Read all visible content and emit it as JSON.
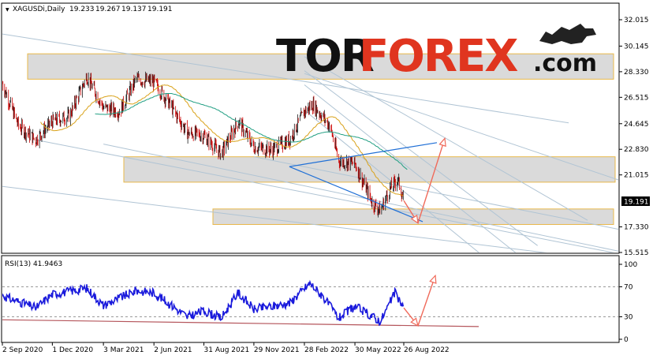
{
  "chart_data": [
    {
      "type": "candlestick",
      "header": {
        "symbol": "XAGUSDi,Daily",
        "open": "19.233",
        "high": "19.267",
        "low": "19.137",
        "close": "19.191"
      },
      "last_price_tag": "19.191",
      "y_ticks": [
        "32.015",
        "30.145",
        "28.330",
        "26.515",
        "24.645",
        "22.830",
        "21.015",
        "19.191",
        "17.330",
        "15.515"
      ],
      "ylim": [
        15.515,
        32.015
      ],
      "x_ticks": [
        "2 Sep 2020",
        "1 Dec 2020",
        "3 Mar 2021",
        "2 Jun 2021",
        "31 Aug 2021",
        "29 Nov 2021",
        "28 Feb 2022",
        "30 May 2022",
        "26 Aug 2022"
      ],
      "approx_close_path": [
        {
          "x": "2 Sep 2020",
          "y": 27.5
        },
        {
          "x": "1 Oct 2020",
          "y": 24.5
        },
        {
          "x": "1 Nov 2020",
          "y": 23.5
        },
        {
          "x": "1 Dec 2020",
          "y": 24.8
        },
        {
          "x": "1 Jan 2021",
          "y": 25.2
        },
        {
          "x": "1 Feb 2021",
          "y": 28.0
        },
        {
          "x": "3 Mar 2021",
          "y": 25.8
        },
        {
          "x": "1 Apr 2021",
          "y": 25.5
        },
        {
          "x": "1 May 2021",
          "y": 27.8
        },
        {
          "x": "2 Jun 2021",
          "y": 27.6
        },
        {
          "x": "1 Jul 2021",
          "y": 26.0
        },
        {
          "x": "1 Aug 2021",
          "y": 24.0
        },
        {
          "x": "31 Aug 2021",
          "y": 23.8
        },
        {
          "x": "1 Oct 2021",
          "y": 22.5
        },
        {
          "x": "1 Nov 2021",
          "y": 24.8
        },
        {
          "x": "29 Nov 2021",
          "y": 23.0
        },
        {
          "x": "1 Jan 2022",
          "y": 22.8
        },
        {
          "x": "1 Feb 2022",
          "y": 23.5
        },
        {
          "x": "28 Feb 2022",
          "y": 25.5
        },
        {
          "x": "15 Mar 2022",
          "y": 26.0
        },
        {
          "x": "15 Apr 2022",
          "y": 24.5
        },
        {
          "x": "1 May 2022",
          "y": 22.0
        },
        {
          "x": "30 May 2022",
          "y": 21.8
        },
        {
          "x": "1 Jul 2022",
          "y": 19.0
        },
        {
          "x": "15 Jul 2022",
          "y": 18.5
        },
        {
          "x": "1 Aug 2022",
          "y": 20.0
        },
        {
          "x": "15 Aug 2022",
          "y": 20.7
        },
        {
          "x": "26 Aug 2022",
          "y": 19.191
        }
      ],
      "zones": [
        {
          "y_from": 27.8,
          "y_to": 29.6
        },
        {
          "y_from": 20.5,
          "y_to": 22.3
        },
        {
          "y_from": 17.5,
          "y_to": 18.6
        }
      ],
      "forecast": {
        "from": 19.191,
        "down_to": 17.6,
        "up_to": 23.6
      },
      "colors": {
        "bull_candle": "#1a1a1a",
        "bear_candle": "#cc0000",
        "ma_fast": "#d9a21a",
        "ma_slow": "#1f9e82",
        "trendline": "#b0c4d4",
        "blue_line": "#1f6fd6",
        "arrow": "#f06a5a",
        "zone_fill": "#d4d4d4",
        "zone_border": "#e8b84a"
      }
    },
    {
      "type": "line",
      "indicator_label": "RSI(13) 41.9463",
      "y_ticks": [
        "100",
        "70",
        "30",
        "0"
      ],
      "ylim": [
        0,
        100
      ],
      "levels": [
        70,
        30
      ],
      "approx_series": [
        {
          "x": "2 Sep 2020",
          "y": 58
        },
        {
          "x": "1 Nov 2020",
          "y": 42
        },
        {
          "x": "1 Dec 2020",
          "y": 60
        },
        {
          "x": "1 Feb 2021",
          "y": 68
        },
        {
          "x": "3 Mar 2021",
          "y": 45
        },
        {
          "x": "1 May 2021",
          "y": 65
        },
        {
          "x": "2 Jun 2021",
          "y": 62
        },
        {
          "x": "1 Aug 2021",
          "y": 30
        },
        {
          "x": "31 Aug 2021",
          "y": 38
        },
        {
          "x": "1 Oct 2021",
          "y": 28
        },
        {
          "x": "1 Nov 2021",
          "y": 62
        },
        {
          "x": "29 Nov 2021",
          "y": 40
        },
        {
          "x": "1 Feb 2022",
          "y": 48
        },
        {
          "x": "10 Mar 2022",
          "y": 75
        },
        {
          "x": "1 Apr 2022",
          "y": 58
        },
        {
          "x": "1 May 2022",
          "y": 28
        },
        {
          "x": "30 May 2022",
          "y": 44
        },
        {
          "x": "15 Jul 2022",
          "y": 24
        },
        {
          "x": "10 Aug 2022",
          "y": 62
        },
        {
          "x": "26 Aug 2022",
          "y": 41.9463
        }
      ],
      "forecast": {
        "from": 41.9463,
        "down_to": 18,
        "up_to": 85
      },
      "colors": {
        "line": "#1a1adc",
        "level": "#9a9a9a",
        "support": "#b5565c",
        "arrow": "#f06a5a"
      }
    }
  ],
  "logo": {
    "part1": "TOR",
    "part2": "FOREX",
    "part3": ".com",
    "colors": {
      "part1": "#111111",
      "part2": "#e0351f",
      "part3": "#111111"
    }
  }
}
